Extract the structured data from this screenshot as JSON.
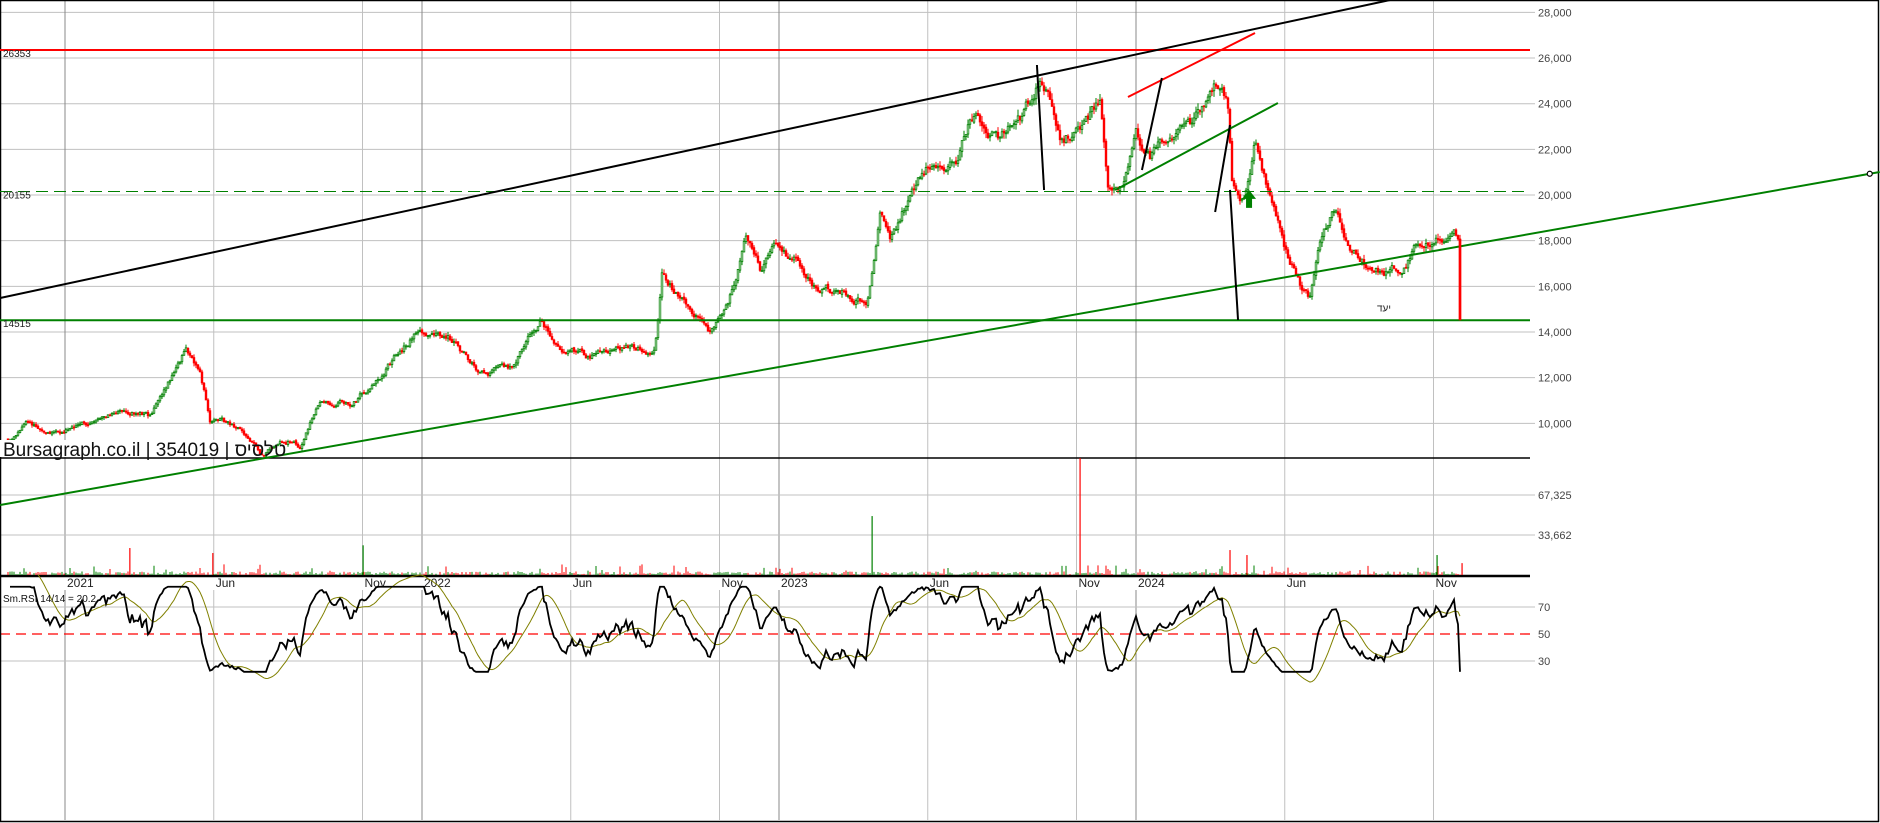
{
  "watermark": "Bursagraph.co.il | 354019 | טלסיס",
  "colors": {
    "up": "#008000",
    "down": "#ff0000",
    "grid": "#c0c0c0",
    "rsi": "#000000",
    "rsi_signal": "#808000"
  },
  "chart_data": {
    "type": "candlestick",
    "title": "Bursagraph.co.il | 354019 | טלסיס",
    "x_unit": "months since Jan 2021",
    "x_ticks": [
      {
        "t": 0,
        "label": "2021"
      },
      {
        "t": 5,
        "label": "Jun"
      },
      {
        "t": 10,
        "label": "Nov"
      },
      {
        "t": 12,
        "label": "2022"
      },
      {
        "t": 17,
        "label": "Jun"
      },
      {
        "t": 22,
        "label": "Nov"
      },
      {
        "t": 24,
        "label": "2023"
      },
      {
        "t": 29,
        "label": "Jun"
      },
      {
        "t": 34,
        "label": "Nov"
      },
      {
        "t": 36,
        "label": "2024"
      },
      {
        "t": 41,
        "label": "Jun"
      },
      {
        "t": 46,
        "label": "Nov"
      }
    ],
    "price_axis": {
      "values": [
        28000,
        26000,
        24000,
        22000,
        20000,
        18000,
        16000,
        14000,
        12000,
        10000
      ],
      "labels": [
        "28,000",
        "26,000",
        "24,000",
        "22,000",
        "20,000",
        "18,000",
        "16,000",
        "14,000",
        "12,000",
        "10,000"
      ]
    },
    "price_path": [
      [
        -1.92,
        9300
      ],
      [
        -1.18,
        10000
      ],
      [
        -0.5,
        9500
      ],
      [
        0,
        9800
      ],
      [
        1.18,
        10200
      ],
      [
        2.18,
        10600
      ],
      [
        2.86,
        10300
      ],
      [
        3.53,
        11800
      ],
      [
        4.03,
        13200
      ],
      [
        4.54,
        12500
      ],
      [
        4.87,
        10200
      ],
      [
        5.88,
        9700
      ],
      [
        6.55,
        8700
      ],
      [
        7.56,
        9200
      ],
      [
        7.9,
        9000
      ],
      [
        8.57,
        11300
      ],
      [
        9.58,
        11000
      ],
      [
        10.59,
        12000
      ],
      [
        11.09,
        13000
      ],
      [
        11.93,
        14200
      ],
      [
        12.94,
        13800
      ],
      [
        13.95,
        12200
      ],
      [
        14.96,
        12400
      ],
      [
        15.97,
        14300
      ],
      [
        16.64,
        13400
      ],
      [
        17.65,
        12900
      ],
      [
        18.66,
        13300
      ],
      [
        19.83,
        13200
      ],
      [
        20.07,
        16500
      ],
      [
        21.01,
        15000
      ],
      [
        21.68,
        13900
      ],
      [
        22.35,
        15600
      ],
      [
        22.86,
        18000
      ],
      [
        23.36,
        16700
      ],
      [
        23.87,
        17900
      ],
      [
        24.71,
        17000
      ],
      [
        25.21,
        15900
      ],
      [
        26.72,
        15600
      ],
      [
        26.96,
        15400
      ],
      [
        27.13,
        17000
      ],
      [
        27.39,
        19200
      ],
      [
        27.73,
        17900
      ],
      [
        28.4,
        20000
      ],
      [
        29.08,
        21500
      ],
      [
        29.92,
        21300
      ],
      [
        30.42,
        23400
      ],
      [
        31.43,
        22500
      ],
      [
        32.1,
        23300
      ],
      [
        32.77,
        25000
      ],
      [
        33.11,
        23900
      ],
      [
        33.45,
        22300
      ],
      [
        34.12,
        23000
      ],
      [
        34.79,
        24000
      ],
      [
        35.06,
        20000
      ],
      [
        35.63,
        20600
      ],
      [
        35.97,
        23000
      ],
      [
        36.47,
        21500
      ],
      [
        37.48,
        23000
      ],
      [
        38.15,
        23300
      ],
      [
        38.66,
        25300
      ],
      [
        39.1,
        23800
      ],
      [
        39.24,
        20500
      ],
      [
        39.66,
        20000
      ],
      [
        40.0,
        22300
      ],
      [
        40.5,
        19600
      ],
      [
        41.01,
        17200
      ],
      [
        41.51,
        16000
      ],
      [
        41.85,
        15600
      ],
      [
        42.18,
        17500
      ],
      [
        42.69,
        19200
      ],
      [
        43.19,
        18000
      ],
      [
        43.87,
        17000
      ],
      [
        44.87,
        16800
      ],
      [
        45.55,
        17900
      ],
      [
        46.22,
        18300
      ],
      [
        46.72,
        18400
      ],
      [
        46.89,
        18000
      ]
    ],
    "last_close": 14515,
    "levels": [
      {
        "price": 26353,
        "label": "26353",
        "color": "#ff0000",
        "style": "solid"
      },
      {
        "price": 20155,
        "label": "20155",
        "color": "#008000",
        "style": "dashed"
      },
      {
        "price": 14515,
        "label": "14515",
        "color": "#008000",
        "style": "solid"
      }
    ],
    "trendlines": [
      {
        "from": [
          -2.18,
          15489
        ],
        "to": [
          44.54,
          28542
        ],
        "color": "#000000"
      },
      {
        "from": [
          -2.18,
          6423
        ],
        "to": [
          61.0,
          21008
        ],
        "color": "#008000",
        "end_marker": true
      },
      {
        "from": [
          35.3,
          20220
        ],
        "to": [
          40.77,
          24030
        ],
        "color": "#008000"
      },
      {
        "from": [
          35.73,
          24293
        ],
        "to": [
          40.0,
          27096
        ],
        "color": "#ff0000"
      },
      {
        "from": [
          32.67,
          25695
        ],
        "to": [
          32.91,
          20220
        ],
        "color": "#000000"
      },
      {
        "from": [
          36.2,
          21096
        ],
        "to": [
          36.87,
          25125
        ],
        "color": "#000000"
      },
      {
        "from": [
          38.66,
          19256
        ],
        "to": [
          39.16,
          23067
        ],
        "color": "#000000"
      },
      {
        "from": [
          39.16,
          20220
        ],
        "to": [
          39.43,
          14526
        ],
        "color": "#000000"
      }
    ],
    "annotations": [
      {
        "t": 44.1,
        "price": 14900,
        "text": "יעד"
      }
    ],
    "arrow": {
      "t": 39.8,
      "price": 19700,
      "direction": "up",
      "color": "#008000"
    },
    "volume_axis": {
      "values": [
        67325,
        33662
      ],
      "labels": [
        "67,325",
        "33,662"
      ]
    },
    "volume_spikes": [
      {
        "t": 2.18,
        "v": 22700,
        "dir": "down"
      },
      {
        "t": 4.97,
        "v": 18500,
        "dir": "down"
      },
      {
        "t": 10.02,
        "v": 25000,
        "dir": "up"
      },
      {
        "t": 27.13,
        "v": 49600,
        "dir": "up"
      },
      {
        "t": 34.12,
        "v": 98400,
        "dir": "down"
      },
      {
        "t": 39.16,
        "v": 21000,
        "dir": "down"
      },
      {
        "t": 39.73,
        "v": 16800,
        "dir": "down"
      },
      {
        "t": 46.12,
        "v": 16800,
        "dir": "up"
      },
      {
        "t": 46.96,
        "v": 10000,
        "dir": "down"
      }
    ],
    "rsi": {
      "label": "Sm.RSI 14/14 = 20.2",
      "period": 14,
      "signal_period": 14,
      "last_value": 20.2,
      "levels": [
        70,
        50,
        30
      ],
      "level_labels": [
        "70",
        "50",
        "30"
      ]
    }
  }
}
